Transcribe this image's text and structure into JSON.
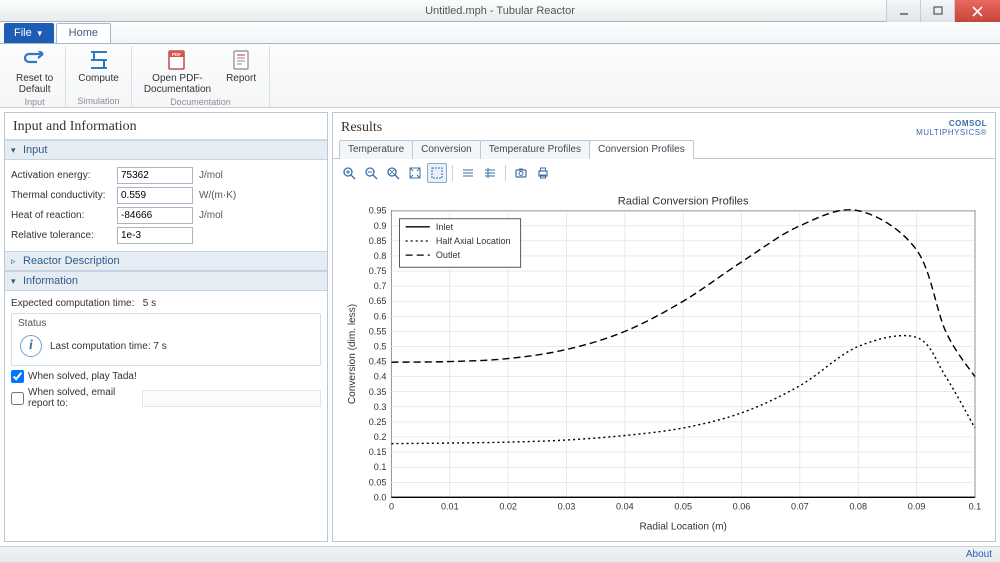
{
  "window": {
    "title": "Untitled.mph - Tubular Reactor"
  },
  "ribbon": {
    "file_label": "File",
    "tabs": {
      "home": "Home"
    },
    "groups": {
      "input": {
        "label": "Input",
        "reset_label": "Reset to\nDefault"
      },
      "simulation": {
        "label": "Simulation",
        "compute_label": "Compute"
      },
      "documentation": {
        "label": "Documentation",
        "pdf_label": "Open PDF-\nDocumentation",
        "report_label": "Report"
      }
    }
  },
  "left": {
    "panel_title": "Input and Information",
    "input_hdr": "Input",
    "fields": {
      "activation": {
        "label": "Activation energy:",
        "value": "75362",
        "unit": "J/mol"
      },
      "thermal": {
        "label": "Thermal conductivity:",
        "value": "0.559",
        "unit": "W/(m·K)"
      },
      "heat": {
        "label": "Heat of reaction:",
        "value": "-84666",
        "unit": "J/mol"
      },
      "reltol": {
        "label": "Relative tolerance:",
        "value": "1e-3",
        "unit": ""
      }
    },
    "reactor_hdr": "Reactor Description",
    "info_hdr": "Information",
    "expected_label": "Expected computation time:",
    "expected_value": "5 s",
    "status_label": "Status",
    "status_text": "Last computation time: 7 s",
    "chk_tada": "When solved, play Tada!",
    "chk_email": "When solved, email report to:"
  },
  "right": {
    "title": "Results",
    "brand_top": "COMSOL",
    "brand_bottom": "MULTIPHYSICS®",
    "tabs": [
      "Temperature",
      "Conversion",
      "Temperature Profiles",
      "Conversion Profiles"
    ],
    "active_tab": 3,
    "chart_title": "Radial Conversion Profiles",
    "xlabel": "Radial Location (m)",
    "ylabel": "Conversion (dim. less)",
    "legend": [
      "Inlet",
      "Half Axial Location",
      "Outlet"
    ]
  },
  "footer": {
    "about": "About"
  },
  "chart_data": {
    "type": "line",
    "title": "Radial Conversion Profiles",
    "xlabel": "Radial Location (m)",
    "ylabel": "Conversion (dim. less)",
    "xlim": [
      0,
      0.1
    ],
    "ylim": [
      0,
      0.95
    ],
    "x": [
      0,
      0.01,
      0.02,
      0.03,
      0.04,
      0.05,
      0.06,
      0.07,
      0.08,
      0.09,
      0.095,
      0.1
    ],
    "series": [
      {
        "name": "Inlet",
        "style": "solid",
        "values": [
          0,
          0,
          0,
          0,
          0,
          0,
          0,
          0,
          0,
          0,
          0,
          0
        ]
      },
      {
        "name": "Half Axial Location",
        "style": "dotted",
        "values": [
          0.178,
          0.18,
          0.183,
          0.19,
          0.205,
          0.23,
          0.28,
          0.37,
          0.5,
          0.53,
          0.4,
          0.23
        ]
      },
      {
        "name": "Outlet",
        "style": "dashed",
        "values": [
          0.448,
          0.45,
          0.46,
          0.49,
          0.55,
          0.65,
          0.78,
          0.9,
          0.95,
          0.82,
          0.55,
          0.4
        ]
      }
    ]
  }
}
